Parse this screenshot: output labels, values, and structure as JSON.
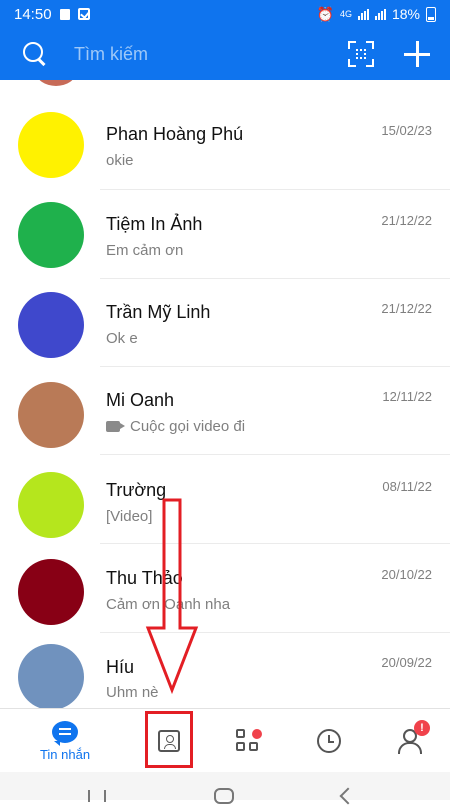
{
  "status_bar": {
    "time": "14:50",
    "battery": "18%",
    "network": "4G"
  },
  "search": {
    "placeholder": "Tìm kiếm"
  },
  "conversations": [
    {
      "name": "Phan Hoàng Phú",
      "message": "okie",
      "time": "15/02/23",
      "avatar_color": "#fff200"
    },
    {
      "name": "Tiệm In Ảnh",
      "message": "Em cảm ơn",
      "time": "21/12/22",
      "avatar_color": "#1fb14c"
    },
    {
      "name": "Trần Mỹ Linh",
      "message": "Ok e",
      "time": "21/12/22",
      "avatar_color": "#3f48cc"
    },
    {
      "name": "Mi Oanh",
      "message": "Cuộc gọi video đi",
      "time": "12/11/22",
      "avatar_color": "#b97a57",
      "message_icon": "video-call-icon"
    },
    {
      "name": "Trường",
      "message": "[Video]",
      "time": "08/11/22",
      "avatar_color": "#b5e61d"
    },
    {
      "name": "Thu Thảo",
      "message": "Cảm ơn Oanh nha",
      "time": "20/10/22",
      "avatar_color": "#880015"
    },
    {
      "name": "Híu",
      "message": "Uhm nè",
      "time": "20/09/22",
      "avatar_color": "#7092be"
    }
  ],
  "bottom_nav": {
    "messages_label": "Tin nhắn",
    "active_color": "#0f74ee",
    "alert_badge": "!",
    "icons": [
      "chat-bubble-icon",
      "contacts-icon",
      "discover-grid-icon",
      "timeline-clock-icon",
      "profile-icon"
    ]
  },
  "annotation": {
    "color": "#e31e24"
  }
}
